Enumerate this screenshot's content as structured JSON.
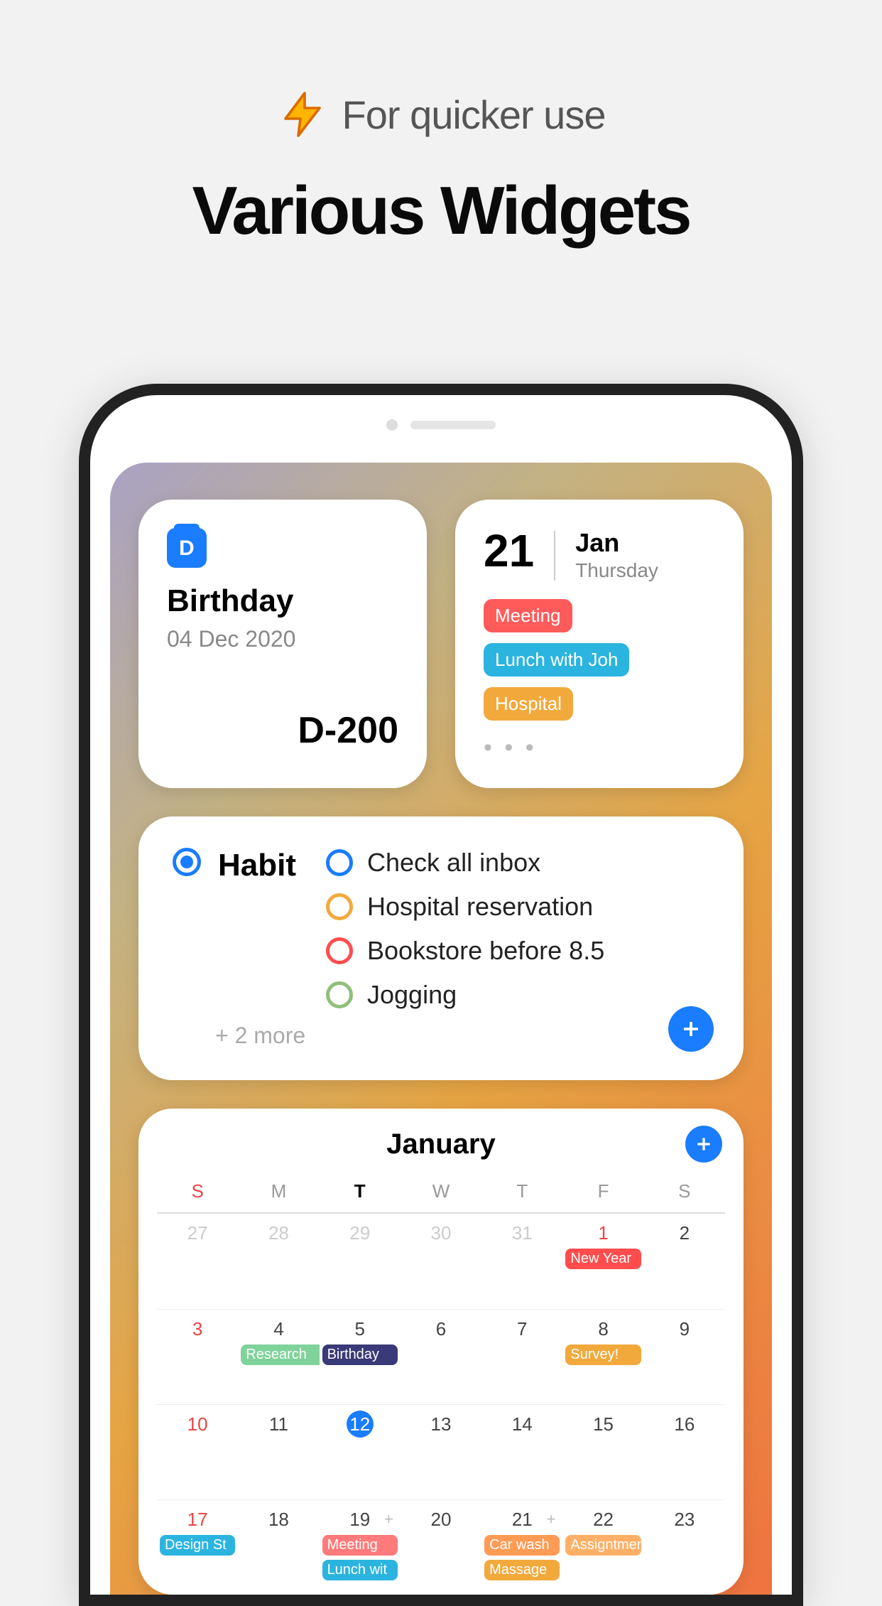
{
  "hero": {
    "tagline": "For quicker use",
    "title": "Various Widgets"
  },
  "dday": {
    "title": "Birthday",
    "date": "04 Dec 2020",
    "count": "D-200"
  },
  "today": {
    "day": "21",
    "month": "Jan",
    "dow": "Thursday",
    "events": [
      {
        "label": "Meeting",
        "color": "#ff5b5b"
      },
      {
        "label": "Lunch with Joh",
        "color": "#2bb4df"
      },
      {
        "label": "Hospital",
        "color": "#f2a93c"
      }
    ],
    "more_glyph": "• • •"
  },
  "habit": {
    "title": "Habit",
    "items": [
      {
        "label": "Check all inbox",
        "color": "#1a7cff"
      },
      {
        "label": "Hospital reservation",
        "color": "#f2a93c"
      },
      {
        "label": "Bookstore before 8.5",
        "color": "#ff4d4d"
      },
      {
        "label": "Jogging",
        "color": "#8fbf7a"
      }
    ],
    "more": "+ 2 more"
  },
  "calendar": {
    "month": "January",
    "dow": [
      "S",
      "M",
      "T",
      "W",
      "T",
      "F",
      "S"
    ],
    "today_dow_index": 2,
    "weeks": [
      {
        "days": [
          {
            "n": "27",
            "cls": "other"
          },
          {
            "n": "28",
            "cls": "other"
          },
          {
            "n": "29",
            "cls": "other"
          },
          {
            "n": "30",
            "cls": "other"
          },
          {
            "n": "31",
            "cls": "other"
          },
          {
            "n": "1",
            "cls": "sun",
            "events": [
              {
                "t": "New Year",
                "c": "#ff4d4d"
              }
            ]
          },
          {
            "n": "2"
          }
        ]
      },
      {
        "days": [
          {
            "n": "3",
            "cls": "sun"
          },
          {
            "n": "4",
            "span_events": [
              {
                "t": "Research",
                "c": "#7fd39a",
                "span": 2
              }
            ]
          },
          {
            "n": "5",
            "events": [
              {
                "t": "Birthday",
                "c": "#3a3a78"
              }
            ]
          },
          {
            "n": "6"
          },
          {
            "n": "7"
          },
          {
            "n": "8",
            "events": [
              {
                "t": "Survey!",
                "c": "#f2a93c"
              }
            ]
          },
          {
            "n": "9"
          }
        ]
      },
      {
        "days": [
          {
            "n": "10",
            "cls": "sun"
          },
          {
            "n": "11"
          },
          {
            "n": "12",
            "today": true
          },
          {
            "n": "13"
          },
          {
            "n": "14"
          },
          {
            "n": "15"
          },
          {
            "n": "16"
          }
        ]
      },
      {
        "days": [
          {
            "n": "17",
            "cls": "sun",
            "events": [
              {
                "t": "Design St",
                "c": "#2bb4df"
              }
            ]
          },
          {
            "n": "18"
          },
          {
            "n": "19",
            "plus": true,
            "events": [
              {
                "t": "Meeting",
                "c": "#ff7a7a"
              },
              {
                "t": "Lunch wit",
                "c": "#2bb4df"
              }
            ]
          },
          {
            "n": "20"
          },
          {
            "n": "21",
            "plus": true,
            "span_events": [
              {
                "t": "Car wash",
                "c": "#ff9b55",
                "span": 1
              }
            ],
            "events": [
              {
                "t": "Massage",
                "c": "#f2a93c"
              }
            ]
          },
          {
            "n": "22",
            "events": [
              {
                "t": "Assigntment",
                "c": "#ffb066"
              }
            ]
          },
          {
            "n": "23"
          }
        ]
      }
    ]
  }
}
